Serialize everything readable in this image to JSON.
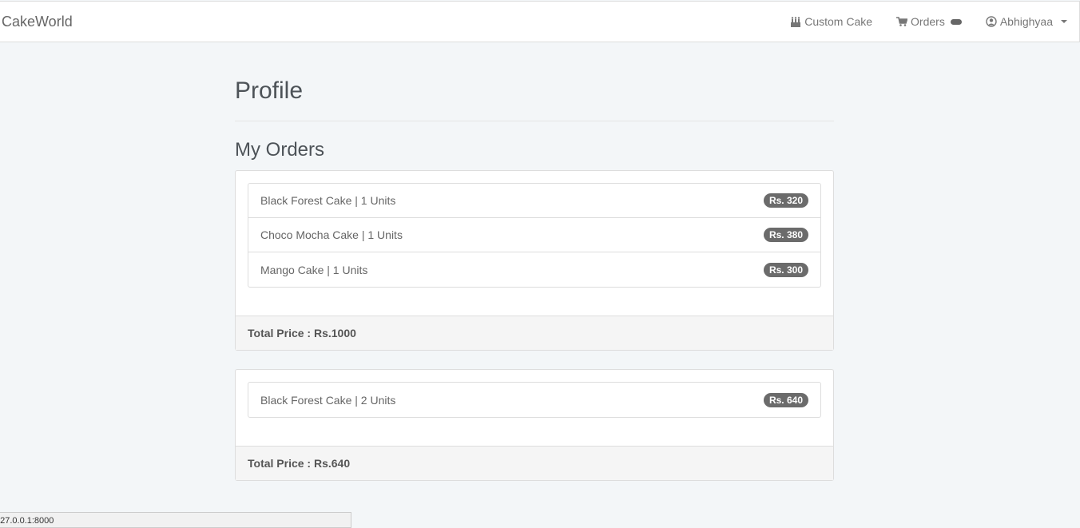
{
  "navbar": {
    "brand": "CakeWorld",
    "custom_cake_label": "Custom Cake",
    "orders_label": "Orders",
    "user_label": "Abhighyaa"
  },
  "page": {
    "title": "Profile",
    "section_title": "My Orders"
  },
  "orders": [
    {
      "items": [
        {
          "label": "Black Forest Cake | 1 Units",
          "price": "Rs. 320"
        },
        {
          "label": "Choco Mocha Cake | 1 Units",
          "price": "Rs. 380"
        },
        {
          "label": "Mango Cake | 1 Units",
          "price": "Rs. 300"
        }
      ],
      "total": "Total Price : Rs.1000"
    },
    {
      "items": [
        {
          "label": "Black Forest Cake | 2 Units",
          "price": "Rs. 640"
        }
      ],
      "total": "Total Price : Rs.640"
    }
  ],
  "status_bar": {
    "url": "127.0.0.1:8000"
  }
}
